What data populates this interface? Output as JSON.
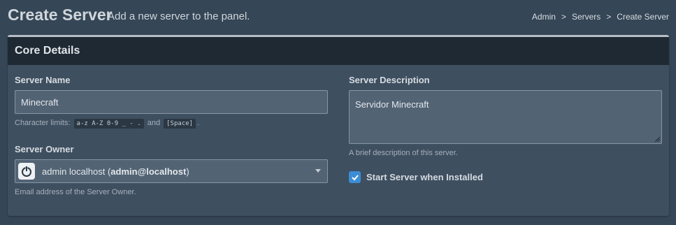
{
  "header": {
    "title": "Create Server",
    "subtitle": "Add a new server to the panel.",
    "breadcrumb": [
      "Admin",
      "Servers",
      "Create Server"
    ],
    "breadcrumb_sep": ">"
  },
  "box": {
    "title": "Core Details"
  },
  "server_name": {
    "label": "Server Name",
    "value": "Minecraft",
    "help_prefix": "Character limits:",
    "help_code1": "a-z A-Z 0-9 _ - .",
    "help_and": "and",
    "help_code2": "[Space]",
    "help_suffix": "."
  },
  "server_owner": {
    "label": "Server Owner",
    "name": "admin localhost (",
    "email": "admin@localhost",
    "close": ")",
    "help": "Email address of the Server Owner."
  },
  "server_description": {
    "label": "Server Description",
    "value": "Servidor Minecraft",
    "help": "A brief description of this server."
  },
  "start_on_install": {
    "label": "Start Server when Installed",
    "checked": true
  },
  "colors": {
    "background": "#354656",
    "box": "#3e4f60",
    "box_header": "#1f2933",
    "checkbox": "#3c8dd5"
  }
}
